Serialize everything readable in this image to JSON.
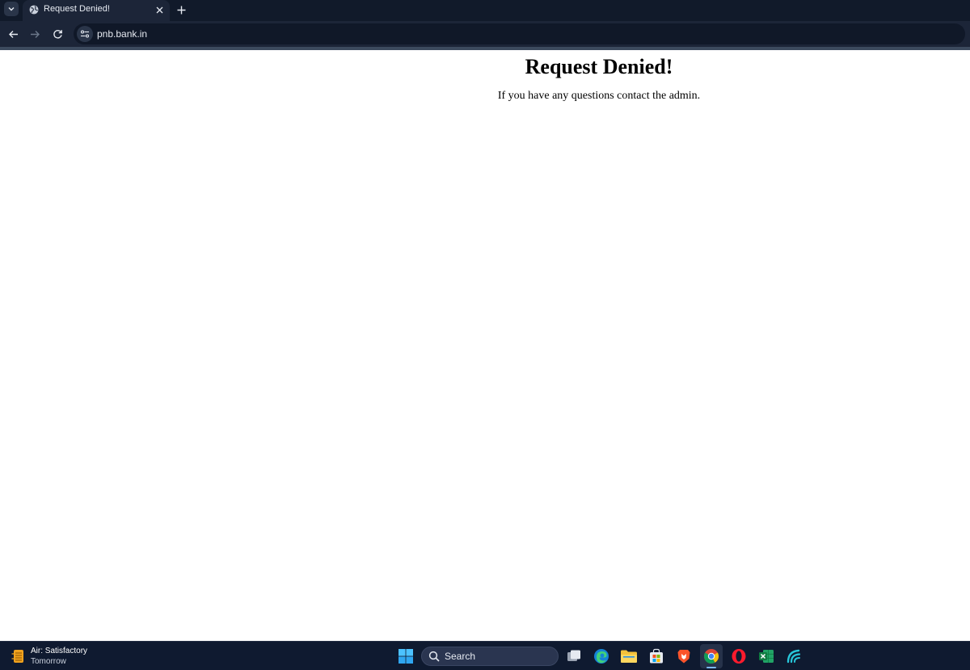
{
  "browser": {
    "tab": {
      "title": "Request Denied!"
    },
    "address_bar": {
      "url": "pnb.bank.in"
    }
  },
  "page": {
    "heading": "Request Denied!",
    "message": "If you have any questions contact the admin."
  },
  "taskbar": {
    "weather": {
      "title": "Air: Satisfactory",
      "subtitle": "Tomorrow"
    },
    "search": {
      "label": "Search"
    },
    "pinned_apps": [
      "start-icon",
      "task-view-icon",
      "edge-icon",
      "file-explorer-icon",
      "store-icon",
      "brave-icon",
      "chrome-icon",
      "opera-icon",
      "excel-icon",
      "app-wave-icon"
    ],
    "accent_color": "#7cb8f5"
  },
  "colors": {
    "chrome_background": "#1c2538",
    "tabstrip_background": "#111a2a",
    "taskbar_background": "#0f1a30",
    "page_background": "#ffffff"
  }
}
